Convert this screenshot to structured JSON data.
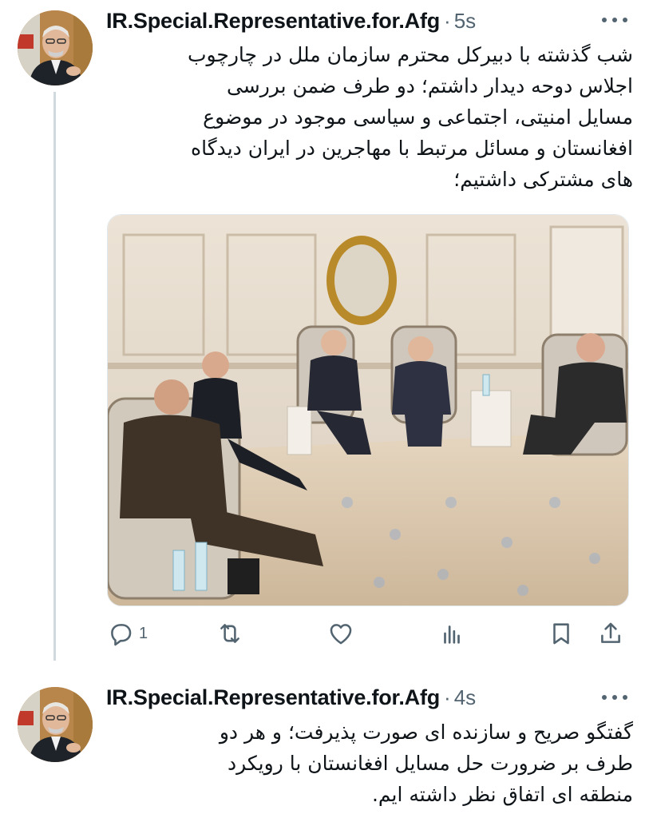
{
  "tweets": [
    {
      "author": "IR.Special.Representative.for.Afg",
      "separator": "·",
      "time": "5s",
      "lines": [
        "شب گذشته با دبیرکل محترم سازمان ملل در چارچوب",
        "اجلاس دوحه دیدار داشتم؛ دو طرف ضمن بررسی",
        "مسایل امنیتی، اجتماعی و سیاسی موجود در موضوع",
        "افغانستان و مسائل مرتبط با مهاجرین در ایران دیدگاه",
        "های مشترکی داشتیم؛"
      ],
      "actions": {
        "reply_count": "1",
        "reply_icon": "reply-icon",
        "retweet_icon": "retweet-icon",
        "like_icon": "like-icon",
        "views_icon": "views-icon",
        "bookmark_icon": "bookmark-icon",
        "share_icon": "share-icon"
      }
    },
    {
      "author": "IR.Special.Representative.for.Afg",
      "separator": "·",
      "time": "4s",
      "lines": [
        "گفتگو صریح و سازنده ای صورت پذیرفت؛ و هر دو",
        "طرف بر ضرورت حل مسایل افغانستان با رویکرد",
        "منطقه ای اتفاق نظر داشته ایم."
      ]
    }
  ],
  "colors": {
    "text": "#0f1419",
    "secondary": "#536471",
    "thread_line": "#cfd9de"
  }
}
